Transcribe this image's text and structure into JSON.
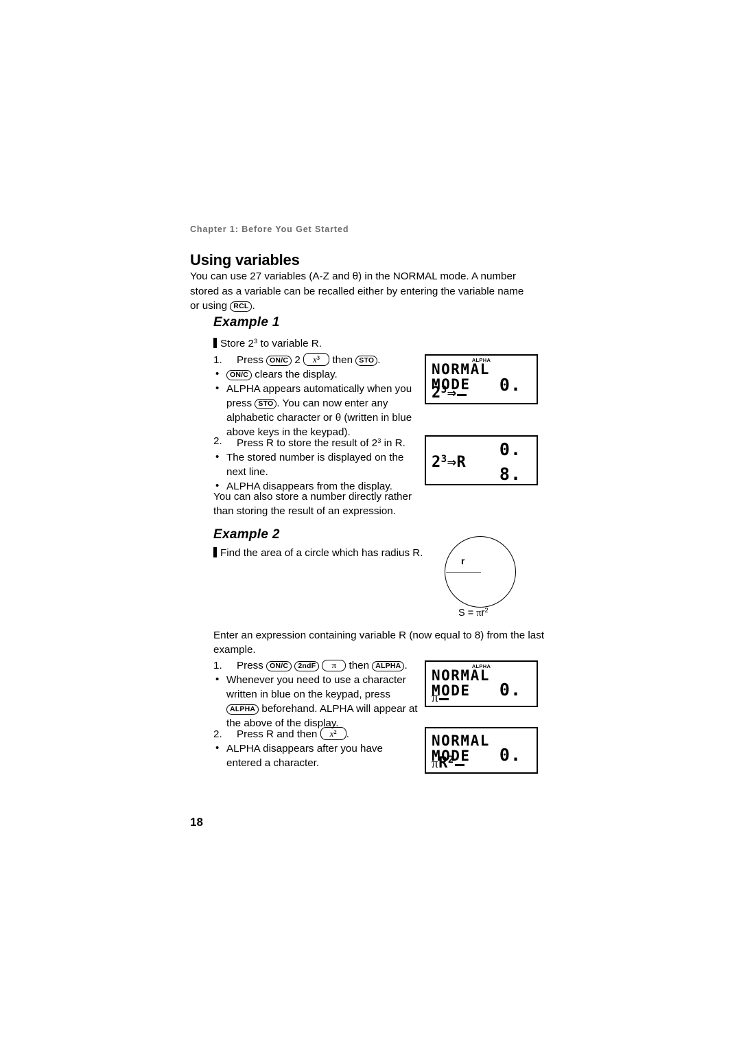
{
  "header": {
    "chapter": "Chapter 1: Before You Get Started"
  },
  "section": {
    "title": "Using variables",
    "intro": "You can use 27 variables (A-Z and θ) in the NORMAL mode. A number stored as a variable can be recalled either by entering the variable name or using"
  },
  "keys": {
    "rcl": "RCL",
    "onc": "ON/C",
    "x3": "x",
    "x3_sup": "3",
    "sto": "STO",
    "alpha": "ALPHA",
    "2ndf": "2ndF",
    "pi": "π",
    "x2": "x",
    "x2_sup": "2"
  },
  "example1": {
    "title": "Example 1",
    "task": "Store 2³ to variable R.",
    "task_pre": "Store 2",
    "task_sup": "3",
    "task_post": " to variable R.",
    "step1_num": "1.",
    "step1_pre": "Press ",
    "step1_mid": "2",
    "step1_then": "then",
    "step1_end": ".",
    "bullet1": "clears the display.",
    "bullet2_pre": "ALPHA appears automatically when you press ",
    "bullet2_post": ". You can now enter any alphabetic character or θ (written in blue above keys in the keypad).",
    "step2_num": "2.",
    "step2_pre": "Press R to store the result of 2",
    "step2_sup": "3",
    "step2_post": " in R.",
    "bullet3": "The stored number is displayed on the next line.",
    "bullet4": "ALPHA disappears from the display.",
    "closing": "You can also store a number directly rather than storing the result of an expression."
  },
  "example2": {
    "title": "Example 2",
    "task": "Find the area of a circle which has radius R.",
    "intro": "Enter an expression containing variable R (now equal to 8) from the last example.",
    "step1_num": "1.",
    "step1_pre": "Press ",
    "step1_then": "then",
    "step1_end": ".",
    "bullet1_pre": "Whenever you need to use a character written in blue on the keypad, press ",
    "bullet1_post": " beforehand. ALPHA will appear at the above of the display.",
    "step2_num": "2.",
    "step2_pre": "Press R and then ",
    "step2_end": ".",
    "bullet2": "ALPHA disappears after you have entered a character."
  },
  "figure": {
    "radius_label": "r",
    "formula_pre": "S = ",
    "formula_pi": "π",
    "formula_var": "r",
    "formula_sup": "2"
  },
  "displays": [
    {
      "id": "display-1",
      "alpha_indicator": "ALPHA",
      "mode": "NORMAL MODE",
      "value_top": "0.",
      "value_bottom": "",
      "entry_pre": "2",
      "entry_sup": "3",
      "entry_arrow": "⇒",
      "entry_post": "",
      "cursor": true
    },
    {
      "id": "display-2",
      "alpha_indicator": "",
      "mode": "",
      "value_top": "0.",
      "value_bottom": "8.",
      "entry_pre": "2",
      "entry_sup": "3",
      "entry_arrow": "⇒",
      "entry_post": "R",
      "cursor": false
    },
    {
      "id": "display-3",
      "alpha_indicator": "ALPHA",
      "mode": "NORMAL MODE",
      "value_top": "0.",
      "value_bottom": "",
      "entry_pre": "π",
      "entry_sup": "",
      "entry_arrow": "",
      "entry_post": "",
      "cursor": true
    },
    {
      "id": "display-4",
      "alpha_indicator": "",
      "mode": "NORMAL MODE",
      "value_top": "0.",
      "value_bottom": "",
      "entry_pre": "πR",
      "entry_sup": "2",
      "entry_arrow": "",
      "entry_post": "",
      "cursor": true
    }
  ],
  "page_number": "18"
}
